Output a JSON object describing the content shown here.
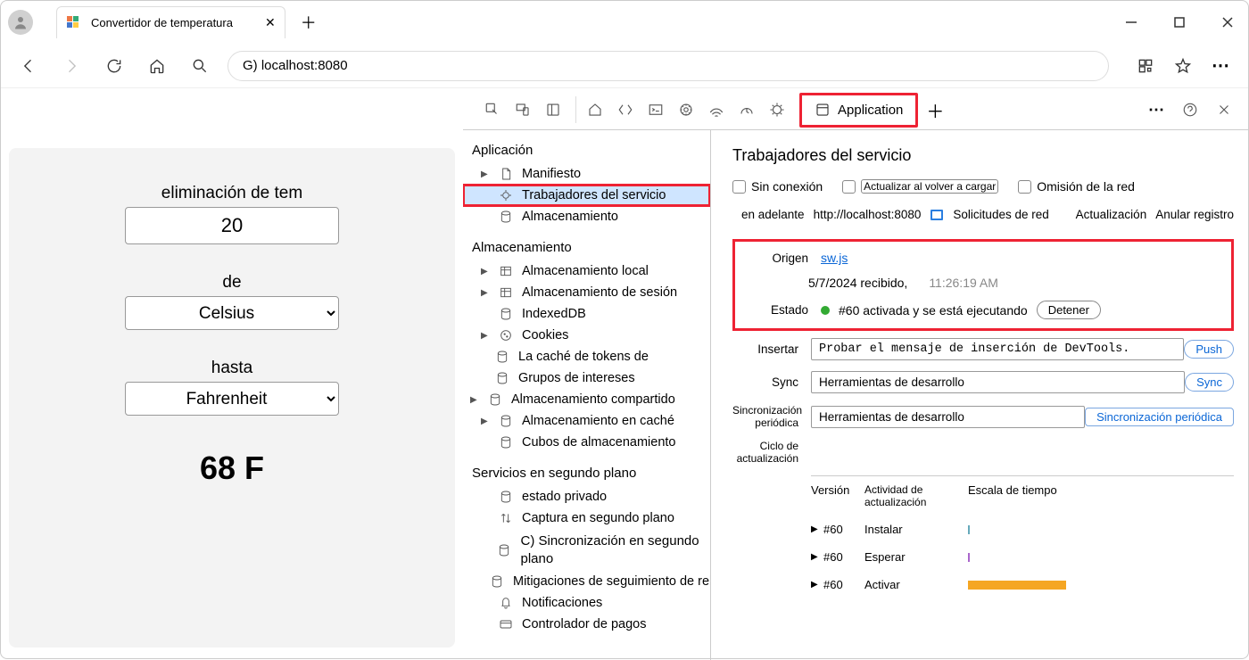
{
  "tab_title": "Convertidor de temperatura",
  "addr": "G) localhost:8080",
  "devtabs": {
    "application": "Application"
  },
  "app": {
    "label_value": "eliminación de tem",
    "value": "20",
    "label_from": "de",
    "from": "Celsius",
    "label_to": "hasta",
    "to": "Fahrenheit",
    "result": "68 F"
  },
  "side": {
    "h1": "Aplicación",
    "manifest": "Manifiesto",
    "sw": "Trabajadores del servicio",
    "storage": "Almacenamiento",
    "h2": "Almacenamiento",
    "local": "Almacenamiento local",
    "session": "Almacenamiento de sesión",
    "idb": "IndexedDB",
    "cookies": "Cookies",
    "tokens": "La caché de tokens de",
    "groups": "Grupos de intereses",
    "shared": "Almacenamiento compartido",
    "cache": "Almacenamiento en caché",
    "buckets": "Cubos de almacenamiento",
    "h3": "Servicios en segundo plano",
    "private": "estado privado",
    "bgfetch": "Captura en segundo plano",
    "bgsync": "C) Sincronización en segundo plano",
    "bounce": "Mitigaciones de seguimiento de rebote",
    "notif": "Notificaciones",
    "payment": "Controlador de pagos"
  },
  "detail": {
    "title": "Trabajadores del servicio",
    "offline": "Sin conexión",
    "reload": "Actualizar al volver a cargar",
    "bypass": "Omisión de la red",
    "urlprefix": "en adelante ",
    "url": "http://localhost:8080",
    "netreq": "Solicitudes de red",
    "update": "Actualización",
    "unregister": "Anular registro",
    "lbl_source": "Origen",
    "source": "sw.js",
    "received": "5/7/2024 recibido,",
    "time": "11:26:19 AM",
    "lbl_status": "Estado",
    "status": "#60 activada y se está ejecutando",
    "stop": "Detener",
    "lbl_push": "Insertar",
    "push_val": "Probar el mensaje de inserción de DevTools.",
    "push_btn": "Push",
    "lbl_sync": "Sync",
    "sync_val": "Herramientas de desarrollo",
    "sync_btn": "Sync",
    "lbl_psync": "Sincronización periódica",
    "psync_val": "Herramientas de desarrollo",
    "psync_btn": "Sincronización periódica",
    "lbl_cycle": "Ciclo de actualización",
    "th_ver": "Versión",
    "th_act": "Actividad de actualización",
    "th_tl": "Escala de tiempo",
    "r1": {
      "v": "#60",
      "a": "Instalar"
    },
    "r2": {
      "v": "#60",
      "a": "Esperar"
    },
    "r3": {
      "v": "#60",
      "a": "Activar"
    }
  }
}
